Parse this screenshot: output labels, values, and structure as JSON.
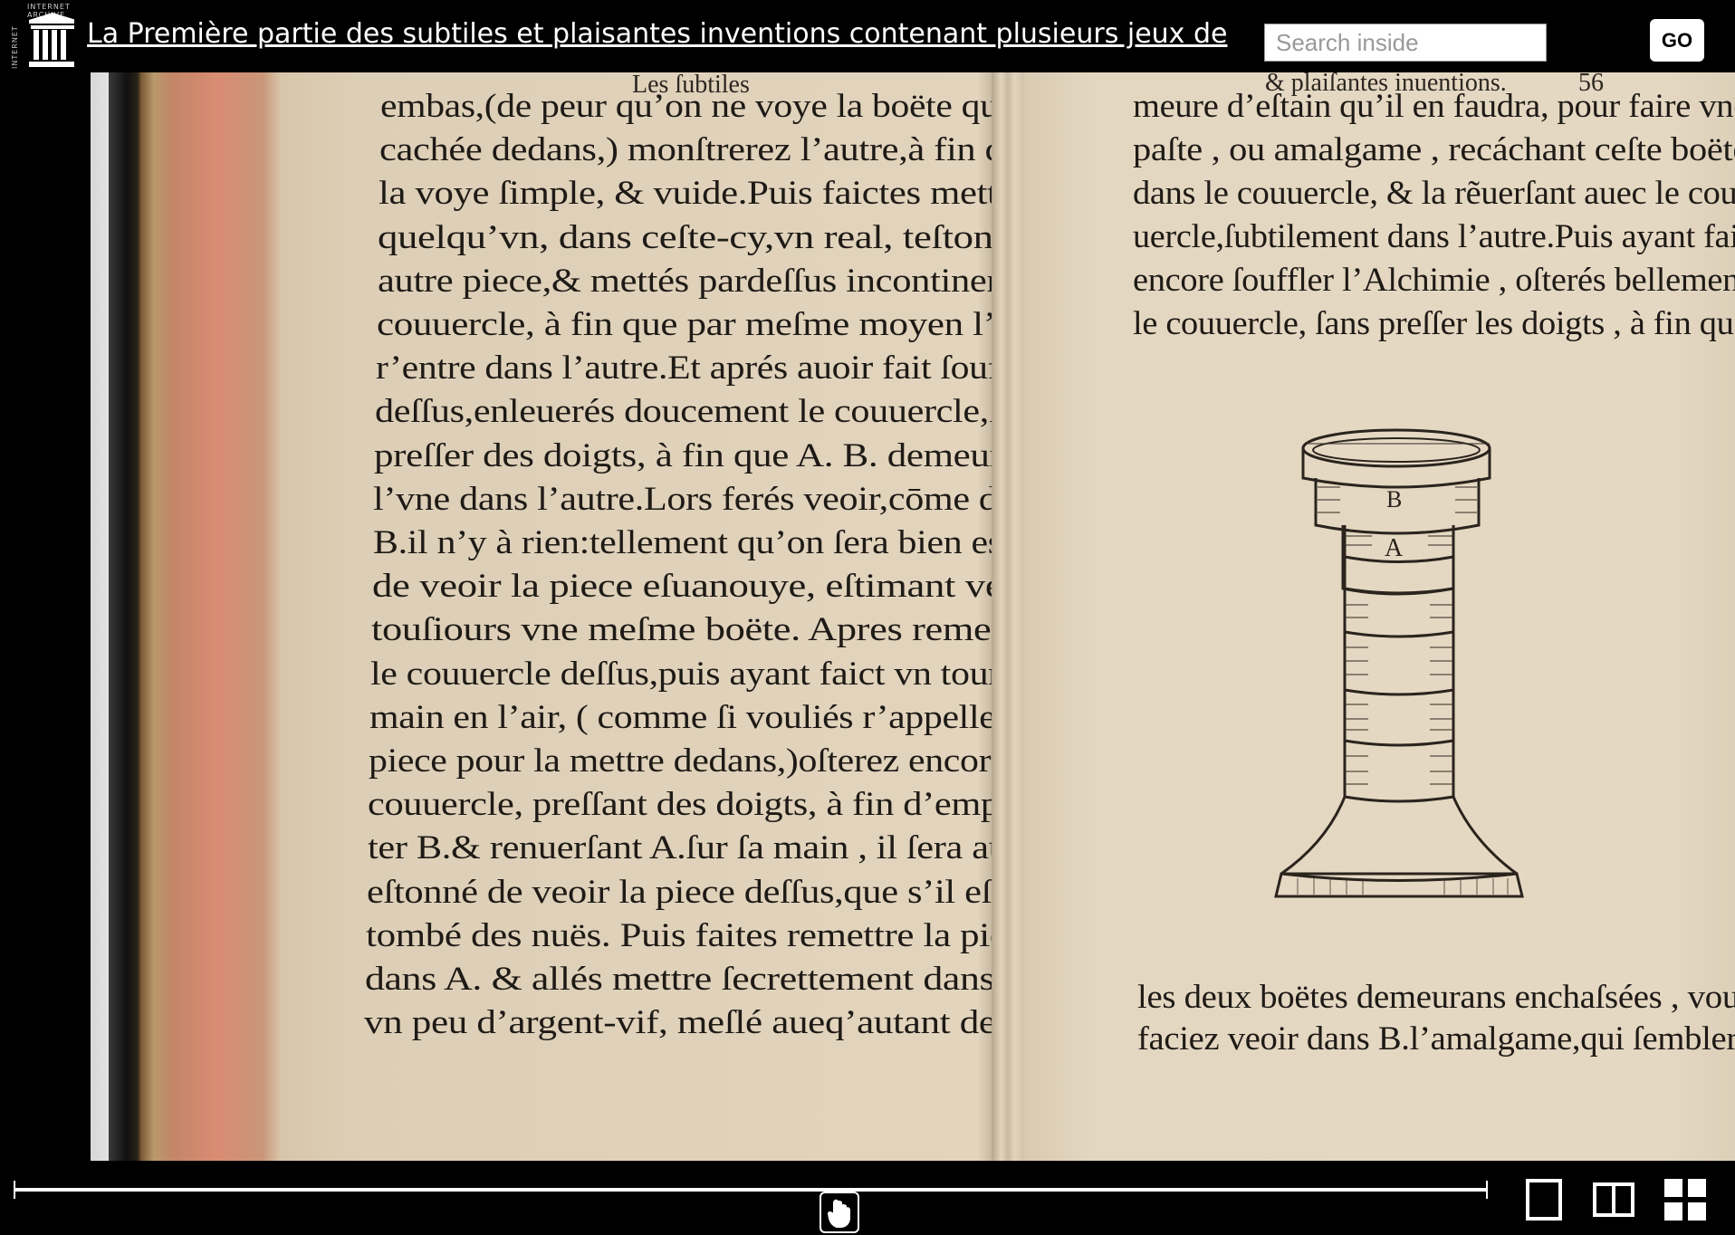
{
  "header": {
    "logo_label": "INTERNET ARCHIVE",
    "title": "La Première partie des subtiles et plaisantes inventions contenant plusieurs jeux de",
    "search_placeholder": "Search inside",
    "go_label": "GO"
  },
  "book": {
    "left_page": {
      "running_head": "Les ſubtiles",
      "lines": [
        "embas,(de peur qu’on ne voye la boëte qui eſt",
        "cachée dedans,) monſtrerez l’autre,à fin qu’ō",
        "la voye ſimple, & vuide.Puis faictes mettre à",
        "quelqu’vn, dans ceſte-cy,vn real, teſton, ou",
        "autre piece,& mettés pardeſſus incontinent le",
        "couuercle, à fin que par meſme moyen l’vne",
        "r’entre dans l’autre.Et aprés auoir fait ſouffler",
        "deſſus,enleuerés doucement le couuercle,ſans",
        "preſſer des doigts, à fin que A. B. demeurent",
        "l’vne dans l’autre.Lors ferés veoir,cōme dans",
        "B.il n’y à rien:tellement qu’on ſera bien esbaï",
        "de veoir la piece eſuanouye, eſtimant veoir",
        "touſiours vne meſme boëte. Apres remettés",
        "le couuercle deſſus,puis ayant faict vn tour de",
        "main en l’air, ( comme ſi vouliés r’appeller la",
        "piece pour la mettre dedans,)oſterez encore le",
        "couuercle, preſſant des doigts, à fin d’empor-",
        "ter B.& renuerſant A.ſur ſa main , il ſera auſsi",
        "eſtonné de veoir la piece deſſus,que s’il eſtoit",
        "tombé des nuës. Puis faites remettre la piece",
        "dans A. & allés mettre ſecrettement dans B.",
        "vn peu d’argent-vif, meſlé aueq’autant de li-"
      ]
    },
    "right_page": {
      "running_head": "& plaiſantes inuentions.",
      "page_number": "56",
      "lines_top": [
        "meure d’eſtain qu’il en faudra, pour faire vne",
        "paſte , ou amalgame , recáchant ceſte boëte",
        "dans le couuercle, & la rẽuerſant auec le cou-",
        "uercle,ſubtilement dans l’autre.Puis ayant fait",
        "encore ſouffler l’Alchimie , oſterés bellement",
        "le couuercle, ſans preſſer les doigts , à fin que"
      ],
      "figure_labels": [
        "B",
        "A"
      ],
      "lines_bottom": [
        "les deux boëtes demeurans enchaſsées , vous",
        "faciez veoir dans B.l’amalgame,qui ſemblera"
      ]
    }
  },
  "navigation": {
    "current_position": 0.56,
    "views": [
      "one-page-view",
      "two-page-view",
      "thumbnail-view"
    ]
  }
}
